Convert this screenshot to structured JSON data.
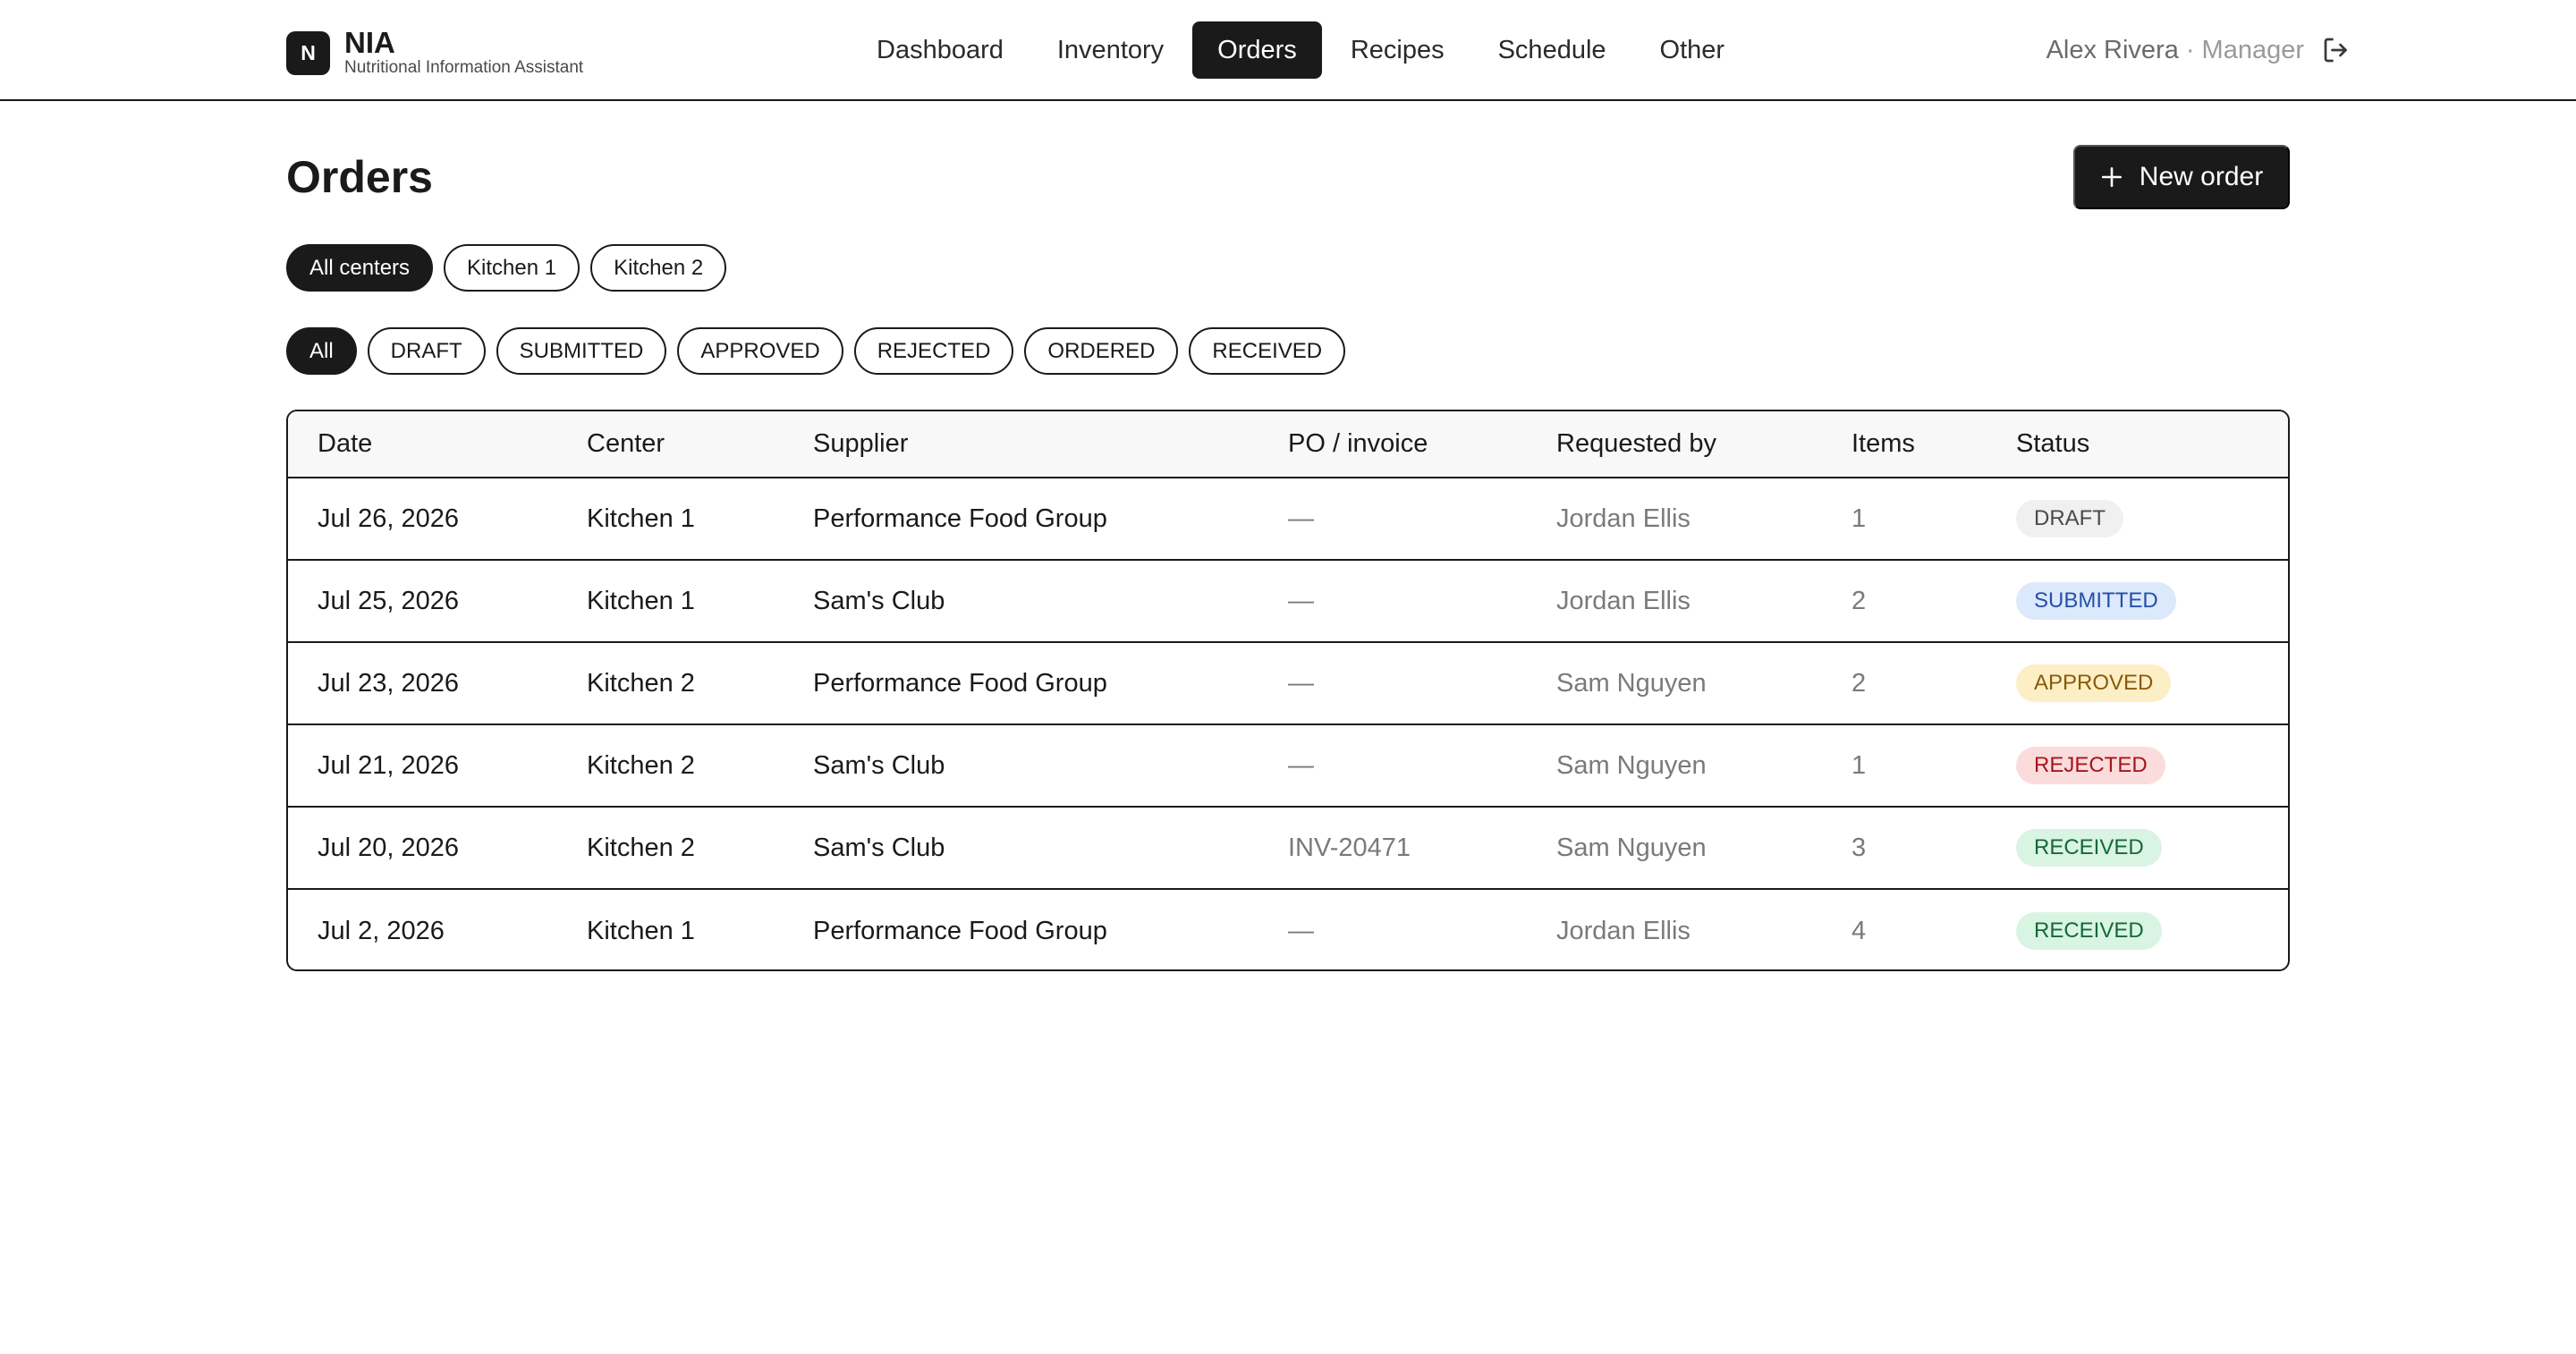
{
  "brand": {
    "logo_letter": "N",
    "name": "NIA",
    "subtitle": "Nutritional Information Assistant"
  },
  "nav": {
    "items": [
      {
        "label": "Dashboard",
        "active": false
      },
      {
        "label": "Inventory",
        "active": false
      },
      {
        "label": "Orders",
        "active": true
      },
      {
        "label": "Recipes",
        "active": false
      },
      {
        "label": "Schedule",
        "active": false
      },
      {
        "label": "Other",
        "active": false
      }
    ]
  },
  "user": {
    "name": "Alex Rivera",
    "separator": "·",
    "role": "Manager",
    "logout_icon": "logout-icon"
  },
  "page": {
    "title": "Orders",
    "new_order_label": "New order",
    "new_order_icon": "plus-icon"
  },
  "center_filters": [
    {
      "label": "All centers",
      "active": true
    },
    {
      "label": "Kitchen 1",
      "active": false
    },
    {
      "label": "Kitchen 2",
      "active": false
    }
  ],
  "status_filters": [
    {
      "label": "All",
      "active": true
    },
    {
      "label": "DRAFT",
      "active": false
    },
    {
      "label": "SUBMITTED",
      "active": false
    },
    {
      "label": "APPROVED",
      "active": false
    },
    {
      "label": "REJECTED",
      "active": false
    },
    {
      "label": "ORDERED",
      "active": false
    },
    {
      "label": "RECEIVED",
      "active": false
    }
  ],
  "table": {
    "headers": [
      "Date",
      "Center",
      "Supplier",
      "PO / invoice",
      "Requested by",
      "Items",
      "Status"
    ],
    "rows": [
      {
        "date": "Jul 26, 2026",
        "center": "Kitchen 1",
        "supplier": "Performance Food Group",
        "po": "—",
        "requested_by": "Jordan Ellis",
        "items": "1",
        "status": "DRAFT"
      },
      {
        "date": "Jul 25, 2026",
        "center": "Kitchen 1",
        "supplier": "Sam's Club",
        "po": "—",
        "requested_by": "Jordan Ellis",
        "items": "2",
        "status": "SUBMITTED"
      },
      {
        "date": "Jul 23, 2026",
        "center": "Kitchen 2",
        "supplier": "Performance Food Group",
        "po": "—",
        "requested_by": "Sam Nguyen",
        "items": "2",
        "status": "APPROVED"
      },
      {
        "date": "Jul 21, 2026",
        "center": "Kitchen 2",
        "supplier": "Sam's Club",
        "po": "—",
        "requested_by": "Sam Nguyen",
        "items": "1",
        "status": "REJECTED"
      },
      {
        "date": "Jul 20, 2026",
        "center": "Kitchen 2",
        "supplier": "Sam's Club",
        "po": "INV-20471",
        "requested_by": "Sam Nguyen",
        "items": "3",
        "status": "RECEIVED"
      },
      {
        "date": "Jul 2, 2026",
        "center": "Kitchen 1",
        "supplier": "Performance Food Group",
        "po": "—",
        "requested_by": "Jordan Ellis",
        "items": "4",
        "status": "RECEIVED"
      }
    ]
  },
  "colors": {
    "primary": "#1a1a1a",
    "draft": "#f0f0f0",
    "submitted": "#dce8fb",
    "approved": "#fcefc5",
    "rejected": "#fbdcdc",
    "received": "#d9f4e3"
  }
}
